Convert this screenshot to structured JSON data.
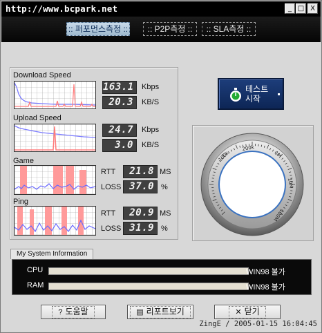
{
  "window": {
    "title": "http://www.bcpark.net",
    "minimize": "_",
    "maximize": "□",
    "close": "X"
  },
  "tabs": [
    {
      "label": ":: 퍼포먼스측정 ::",
      "active": true
    },
    {
      "label": ":: P2P측정 ::",
      "active": false
    },
    {
      "label": ":: SLA측정 ::",
      "active": false
    }
  ],
  "graphs": {
    "download": {
      "label": "Download Speed",
      "value1": "163.1",
      "unit1": "Kbps",
      "value2": "20.3",
      "unit2": "KB/S"
    },
    "upload": {
      "label": "Upload Speed",
      "value1": "24.7",
      "unit1": "Kbps",
      "value2": "3.0",
      "unit2": "KB/S"
    },
    "game": {
      "label": "Game",
      "rtt_label": "RTT",
      "rtt": "21.8",
      "rtt_unit": "MS",
      "loss_label": "LOSS",
      "loss": "37.0",
      "loss_unit": "%"
    },
    "ping": {
      "label": "Ping",
      "rtt_label": "RTT",
      "rtt": "20.9",
      "rtt_unit": "MS",
      "loss_label": "LOSS",
      "loss": "31.9",
      "loss_unit": "%"
    }
  },
  "start_button": {
    "line1": "테스트",
    "line2": "시작"
  },
  "gauge": {
    "labels": [
      "100k",
      "200k",
      "1M",
      "10M",
      "100M"
    ]
  },
  "system_info": {
    "title": "My System Information",
    "rows": [
      {
        "label": "CPU",
        "value": "WIN98 불가"
      },
      {
        "label": "RAM",
        "value": "WIN98 불가"
      }
    ]
  },
  "buttons": {
    "help": "도움말",
    "report": "리포트보기",
    "close": "닫기"
  },
  "footer": "ZingE / 2005-01-15 16:04:45"
}
